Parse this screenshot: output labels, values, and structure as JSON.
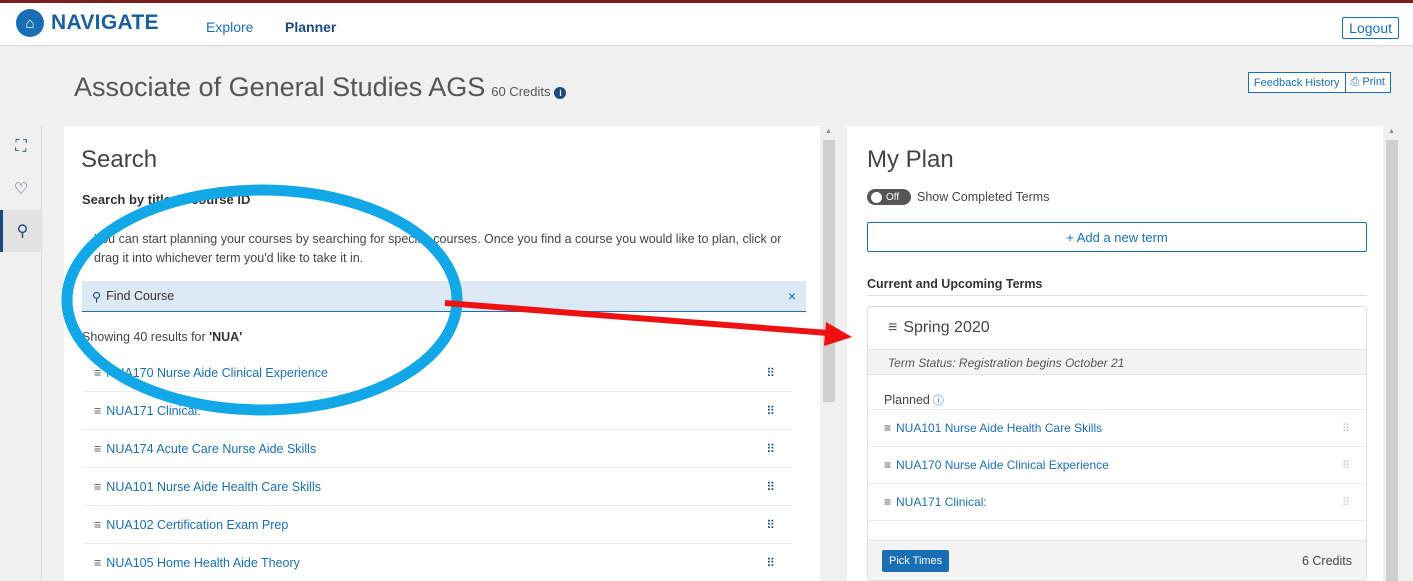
{
  "topbar": {
    "brand": "NAVIGATE",
    "logo_glyph": "⌂",
    "nav": [
      {
        "label": "Explore"
      },
      {
        "label": "Planner"
      }
    ],
    "logout_label": "Logout"
  },
  "header": {
    "title": "Associate of General Studies AGS",
    "credits": "60 Credits",
    "info_glyph": "i",
    "feedback_label": "Feedback History",
    "print_label": "⎙ Print"
  },
  "sidebar": {
    "items": [
      {
        "icon": "map-pin-icon",
        "glyph": "⛶"
      },
      {
        "icon": "heart-icon",
        "glyph": "♡"
      },
      {
        "icon": "search-icon",
        "glyph": "⚲"
      }
    ]
  },
  "search": {
    "title": "Search",
    "subtitle": "Search by title or course ID",
    "description": "You can start planning your courses by searching for specific courses. Once you find a course you would like to plan, click or drag it into whichever term you'd like to take it in.",
    "find_label": "Find Course",
    "find_icon": "⚲",
    "clear_glyph": "×",
    "results_prefix": "Showing 40 results for ",
    "results_query": "'NUA'",
    "courses": [
      {
        "label": "NUA170 Nurse Aide Clinical Experience"
      },
      {
        "label": "NUA171 Clinical:"
      },
      {
        "label": "NUA174 Acute Care Nurse Aide Skills"
      },
      {
        "label": "NUA101 Nurse Aide Health Care Skills"
      },
      {
        "label": "NUA102 Certification Exam Prep"
      },
      {
        "label": "NUA105 Home Health Aide Theory"
      }
    ]
  },
  "plan": {
    "title": "My Plan",
    "toggle_label": "Off",
    "toggle_text": "Show Completed Terms",
    "add_term_label": "+ Add a new term",
    "section_label": "Current and Upcoming Terms",
    "term": {
      "name": "Spring 2020",
      "status": "Term Status: Registration begins October 21",
      "planned_label": "Planned",
      "planned_info": "ⓘ",
      "courses": [
        {
          "label": "NUA101 Nurse Aide Health Care Skills"
        },
        {
          "label": "NUA170 Nurse Aide Clinical Experience"
        },
        {
          "label": "NUA171 Clinical:"
        }
      ],
      "pick_times_label": "Pick Times",
      "credits": "6 Credits"
    }
  },
  "glyphs": {
    "hamburger": "≡",
    "drag": "⠿"
  },
  "colors": {
    "brand": "#1a6fb4",
    "annotation_circle": "#12a7e6",
    "annotation_arrow": "#ee1111"
  }
}
